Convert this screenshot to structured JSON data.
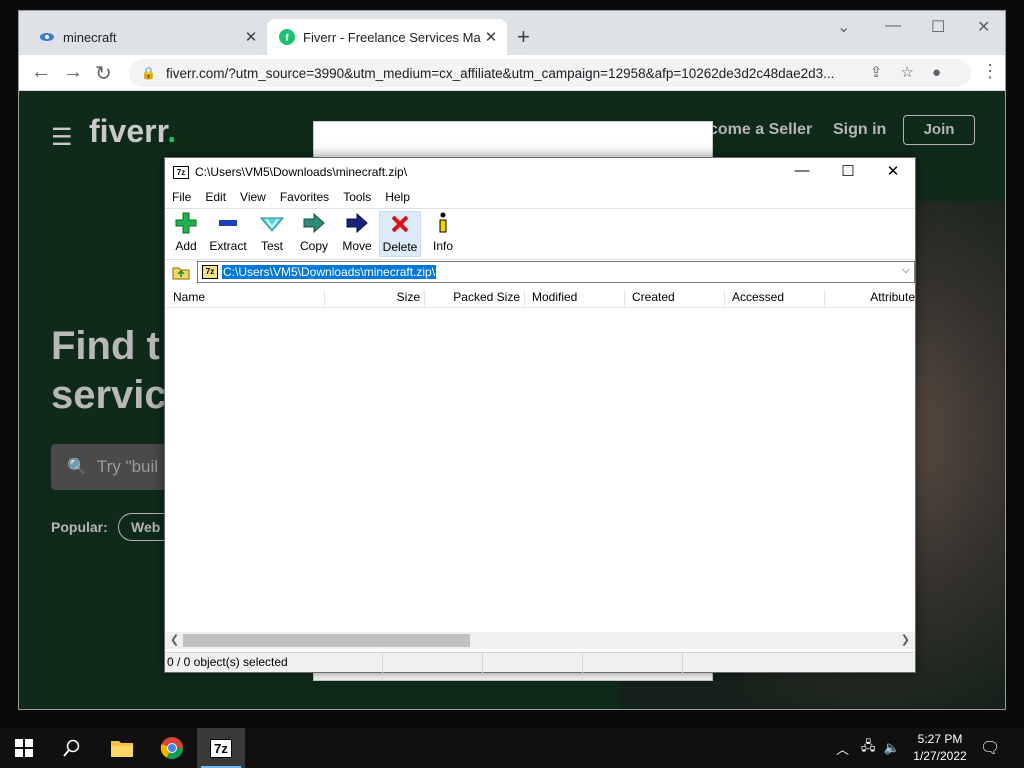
{
  "browser": {
    "tabs": [
      {
        "title": "minecraft",
        "close": "✕"
      },
      {
        "title": "Fiverr - Freelance Services Marke",
        "close": "✕"
      }
    ],
    "new_tab": "+",
    "url": "fiverr.com/?utm_source=3990&utm_medium=cx_affiliate&utm_campaign=12958&afp=10262de3d2c48dae2d3..."
  },
  "fiverr": {
    "logo": "fiverr",
    "logo_dot": ".",
    "nav_become_seller": "come a Seller",
    "nav_sign_in": "Sign in",
    "nav_join": "Join",
    "hero_line1": "Find t",
    "hero_line2": "servic",
    "search_placeholder": "Try \"buil",
    "popular_label": "Popular:",
    "popular_chip": "Web"
  },
  "sevenzip": {
    "title": "C:\\Users\\VM5\\Downloads\\minecraft.zip\\",
    "menu": [
      "File",
      "Edit",
      "View",
      "Favorites",
      "Tools",
      "Help"
    ],
    "toolbar": [
      "Add",
      "Extract",
      "Test",
      "Copy",
      "Move",
      "Delete",
      "Info"
    ],
    "address": "C:\\Users\\VM5\\Downloads\\minecraft.zip\\",
    "columns": [
      "Name",
      "Size",
      "Packed Size",
      "Modified",
      "Created",
      "Accessed",
      "Attribute"
    ],
    "status": "0 / 0 object(s) selected",
    "app_icon_label": "7z"
  },
  "taskbar": {
    "time": "5:27 PM",
    "date": "1/27/2022",
    "sevenzip_label": "7z"
  },
  "colors": {
    "fiverr_green": "#1dbf73",
    "selection": "#0078d7",
    "taskbar": "#101010"
  }
}
